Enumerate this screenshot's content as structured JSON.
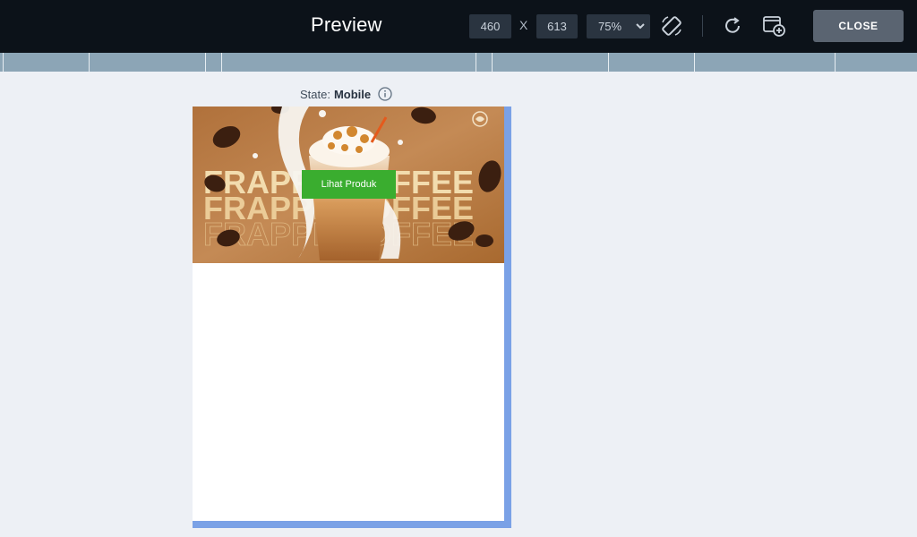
{
  "header": {
    "title": "Preview",
    "width_value": "460",
    "height_value": "613",
    "separator": "X",
    "zoom": "75%",
    "close_label": "CLOSE"
  },
  "state": {
    "prefix": "State:",
    "value": "Mobile"
  },
  "banner": {
    "button_label": "Lihat Produk",
    "big_text_1": "FRAPPE COFFEE",
    "big_text_2": "FRAPPE COFFEE",
    "big_text_3": "FRAPPE COFFEE"
  },
  "colors": {
    "topbar": "#0c1219",
    "ruler": "#8ca5b6",
    "frame_accent": "#7aa1e6",
    "button_green": "#3aad2f",
    "close_button": "#5a6471"
  },
  "icons": {
    "rotate": "rotate-device-icon",
    "refresh": "refresh-icon",
    "add_window": "add-window-icon",
    "info": "info-icon"
  }
}
